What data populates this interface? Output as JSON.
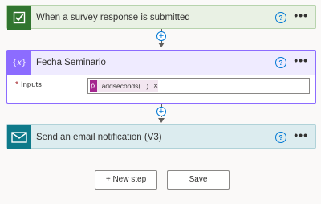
{
  "colors": {
    "trigger_bg": "#e9f1e4",
    "forms_green": "#31752f",
    "compose_purple": "#8c6cff",
    "compose_header_bg": "#efebff",
    "outlook_teal": "#0e7a8a",
    "email_bg": "#dcecef",
    "link_blue": "#0078d4",
    "expression_magenta": "#a4268f",
    "token_bg": "#f2e6f0"
  },
  "trigger": {
    "title": "When a survey response is submitted",
    "icon": "forms-checklist-icon",
    "help_glyph": "?",
    "more_glyph": "•••"
  },
  "connector1": {
    "plus_glyph": "+"
  },
  "compose": {
    "title": "Fecha Seminario",
    "icon": "compose-braces-icon",
    "icon_glyph": "{𝑥}",
    "help_glyph": "?",
    "more_glyph": "•••",
    "inputs_required_mark": "*",
    "inputs_label": "Inputs",
    "token": {
      "icon_glyph": "fx",
      "label": "addseconds(...)",
      "remove_glyph": "×"
    }
  },
  "connector2": {
    "plus_glyph": "+"
  },
  "email": {
    "title": "Send an email notification (V3)",
    "icon": "mail-envelope-icon",
    "help_glyph": "?",
    "more_glyph": "•••"
  },
  "footer": {
    "new_step_label": "+ New step",
    "save_label": "Save"
  }
}
